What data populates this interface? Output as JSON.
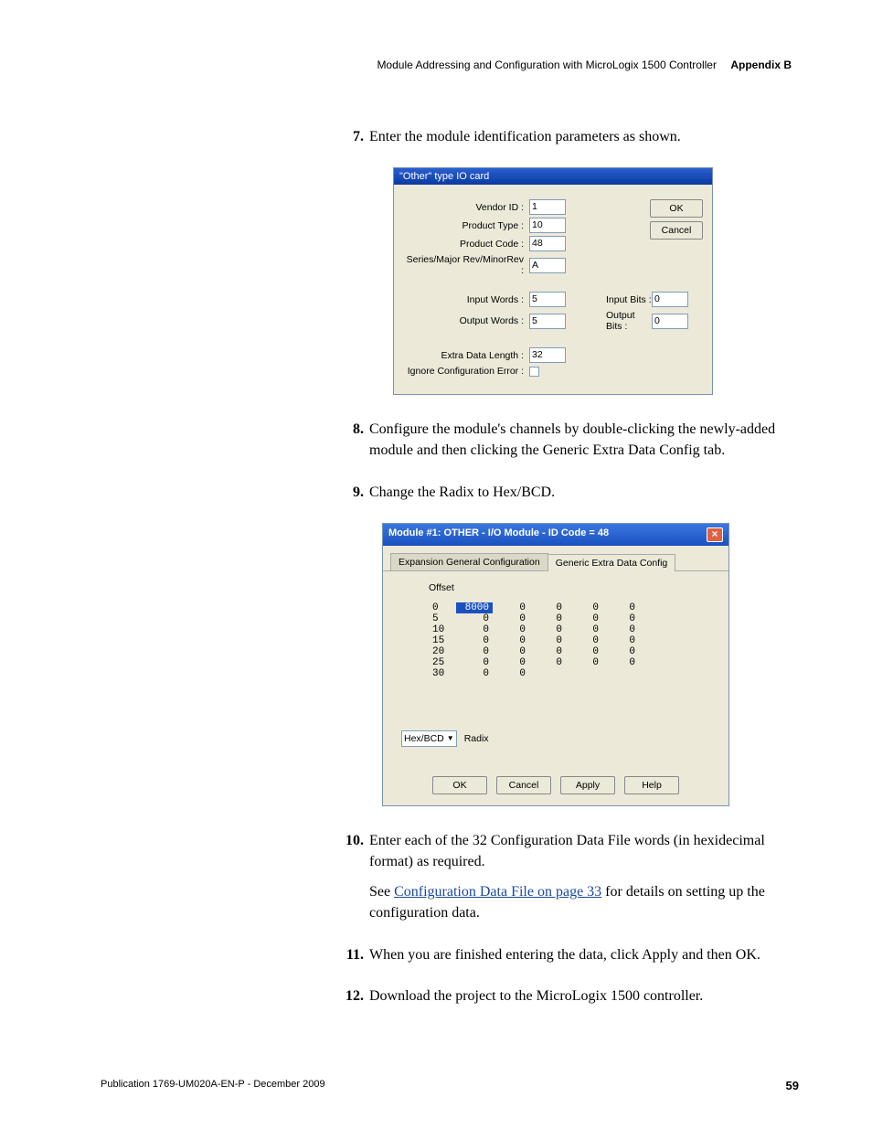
{
  "header": {
    "title": "Module Addressing and Configuration with MicroLogix 1500 Controller",
    "appendix": "Appendix B"
  },
  "steps": {
    "7": {
      "num": "7.",
      "text": "Enter the module identification parameters as shown."
    },
    "8": {
      "num": "8.",
      "text": "Configure the module's channels by double-clicking the newly-added module and then clicking the Generic Extra Data Config tab."
    },
    "9": {
      "num": "9.",
      "text": "Change the Radix to Hex/BCD."
    },
    "10": {
      "num": "10.",
      "text": "Enter each of the 32 Configuration Data File words (in hexidecimal format) as required.",
      "text2a": "See ",
      "link": "Configuration Data File on page 33",
      "text2b": " for details on setting up the configuration data."
    },
    "11": {
      "num": "11.",
      "text": "When you are finished entering the data, click Apply and then OK."
    },
    "12": {
      "num": "12.",
      "text": "Download the project to the MicroLogix 1500 controller."
    }
  },
  "dialog1": {
    "title": "\"Other\" type IO card",
    "fields": {
      "vendor_id": {
        "label": "Vendor ID :",
        "value": "1"
      },
      "product_type": {
        "label": "Product Type :",
        "value": "10"
      },
      "product_code": {
        "label": "Product Code :",
        "value": "48"
      },
      "series": {
        "label": "Series/Major Rev/MinorRev :",
        "value": "A"
      },
      "input_words": {
        "label": "Input Words :",
        "value": "5"
      },
      "input_bits": {
        "label": "Input Bits :",
        "value": "0"
      },
      "output_words": {
        "label": "Output Words :",
        "value": "5"
      },
      "output_bits": {
        "label": "Output Bits :",
        "value": "0"
      },
      "extra_data": {
        "label": "Extra Data Length :",
        "value": "32"
      },
      "ignore_err": {
        "label": "Ignore Configuration Error :"
      }
    },
    "buttons": {
      "ok": "OK",
      "cancel": "Cancel"
    }
  },
  "dialog2": {
    "title": "Module #1: OTHER - I/O Module - ID Code = 48",
    "tabs": {
      "tab1": "Expansion General Configuration",
      "tab2": "Generic Extra Data Config"
    },
    "offset_label": "Offset",
    "table": {
      "rows": [
        {
          "offset": "0",
          "cells": [
            "8000",
            "0",
            "0",
            "0",
            "0"
          ]
        },
        {
          "offset": "5",
          "cells": [
            "0",
            "0",
            "0",
            "0",
            "0"
          ]
        },
        {
          "offset": "10",
          "cells": [
            "0",
            "0",
            "0",
            "0",
            "0"
          ]
        },
        {
          "offset": "15",
          "cells": [
            "0",
            "0",
            "0",
            "0",
            "0"
          ]
        },
        {
          "offset": "20",
          "cells": [
            "0",
            "0",
            "0",
            "0",
            "0"
          ]
        },
        {
          "offset": "25",
          "cells": [
            "0",
            "0",
            "0",
            "0",
            "0"
          ]
        },
        {
          "offset": "30",
          "cells": [
            "0",
            "0",
            "",
            "",
            ""
          ]
        }
      ]
    },
    "radix": {
      "value": "Hex/BCD",
      "label": "Radix"
    },
    "buttons": {
      "ok": "OK",
      "cancel": "Cancel",
      "apply": "Apply",
      "help": "Help"
    }
  },
  "footer": {
    "pub": "Publication 1769-UM020A-EN-P - December 2009",
    "page": "59"
  }
}
